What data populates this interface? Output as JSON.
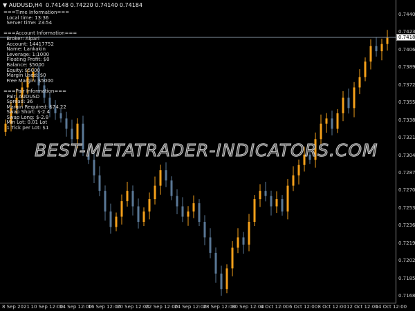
{
  "header": {
    "symbol": "AUDUSD,H4",
    "ohlc": "0.74148 0.74220 0.74140 0.74184"
  },
  "info_lines": [
    "===Time Information===",
    "  Local time: 13:36",
    "  Server time: 23:54",
    "",
    "===Account Information===",
    "  Broker: Alpari",
    "  Account: 14417752",
    "  Name: Lankakin",
    "  Leverage: 1:1000",
    "  Floating Profit: $0",
    "  Balance: $5000",
    "  Equity: $5000",
    "  Margin Used: $0",
    "  Free Margin: $5000",
    "",
    "===Pair Information===",
    "  Pair: AUDUSD",
    "  Spread: 36",
    "  Margin Required: $74.22",
    "  Swap Short: $-2.4",
    "  Swap Long: $-2.8",
    "  Min Lot: 0.01 Lot",
    "  1 Tick per Lot: $1"
  ],
  "watermark": "BEST-METATRADER-INDICATORS.COM",
  "current_price": "0.74184",
  "price_axis": [
    "0.74405",
    "0.74235",
    "0.74065",
    "0.73895",
    "0.73725",
    "0.73555",
    "0.73385",
    "0.73215",
    "0.73045",
    "0.72875",
    "0.72705",
    "0.72535",
    "0.72365",
    "0.72195",
    "0.72025",
    "0.71855",
    "0.71685"
  ],
  "time_axis": [
    "8 Sep 2021",
    "10 Sep 12:00",
    "14 Sep 12:00",
    "16 Sep 12:00",
    "20 Sep 12:00",
    "22 Sep 12:00",
    "24 Sep 12:00",
    "28 Sep 12:00",
    "30 Sep 12:00",
    "4 Oct 12:00",
    "6 Oct 12:00",
    "8 Oct 12:00",
    "12 Oct 12:00",
    "14 Oct 12:00"
  ],
  "colors": {
    "bull": "#f5a01a",
    "bear": "#5a7896"
  },
  "closes": [
    0.7335,
    0.735,
    0.736,
    0.737,
    0.738,
    0.7385,
    0.7372,
    0.736,
    0.735,
    0.7345,
    0.734,
    0.733,
    0.732,
    0.7335,
    0.731,
    0.73,
    0.7285,
    0.727,
    0.725,
    0.7235,
    0.7245,
    0.726,
    0.727,
    0.7255,
    0.724,
    0.725,
    0.7262,
    0.7275,
    0.729,
    0.728,
    0.7265,
    0.7255,
    0.7245,
    0.725,
    0.7258,
    0.724,
    0.7225,
    0.721,
    0.719,
    0.7175,
    0.7195,
    0.7215,
    0.7225,
    0.7218,
    0.724,
    0.7262,
    0.727,
    0.7265,
    0.7255,
    0.7262,
    0.725,
    0.7275,
    0.7285,
    0.7295,
    0.7305,
    0.73,
    0.732,
    0.7335,
    0.734,
    0.733,
    0.7345,
    0.736,
    0.735,
    0.737,
    0.738,
    0.7395,
    0.741,
    0.7405,
    0.7412,
    0.7418
  ]
}
